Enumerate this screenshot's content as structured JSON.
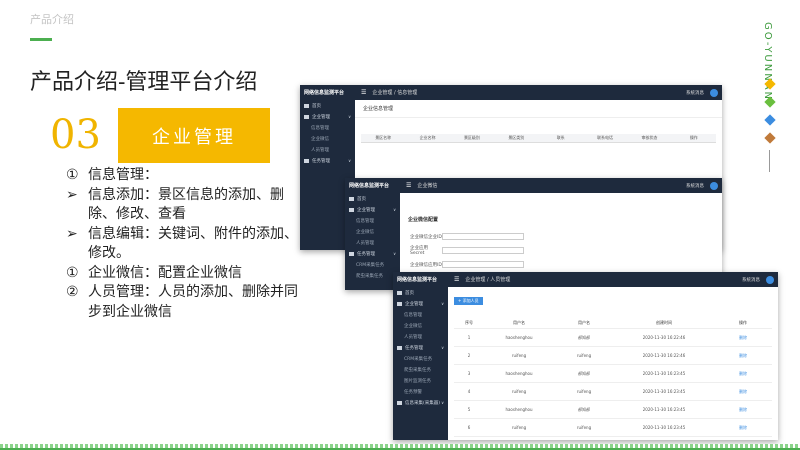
{
  "page": {
    "top_label": "产品介绍",
    "brand": "GO-YUNNAN",
    "title": "产品介绍-管理平台介绍",
    "section_number": "03",
    "section_title": "企业管理",
    "colors": {
      "accent_yellow": "#f5b800",
      "accent_green": "#4caf50",
      "diamond_1": "#f5b800",
      "diamond_2": "#6abf3e",
      "diamond_3": "#3c8de0",
      "diamond_4": "#c07a3a"
    }
  },
  "points": [
    {
      "marker": "①",
      "text": "信息管理："
    },
    {
      "marker": "➢",
      "text": "信息添加：景区信息的添加、删除、修改、查看"
    },
    {
      "marker": "➢",
      "text": "信息编辑：关键词、附件的添加、修改。"
    },
    {
      "marker": "①",
      "text": "企业微信：配置企业微信"
    },
    {
      "marker": "②",
      "text": "人员管理：人员的添加、删除并同步到企业微信"
    }
  ],
  "app": {
    "name": "网络信息监测平台",
    "sys_label": "系统消息",
    "sidebar": {
      "home": "首页",
      "enterprise": "企业管理",
      "info_manage": "信息管理",
      "enterprise_wechat": "企业微信",
      "staff": "人员管理",
      "tasks": "任务管理",
      "task_1": "CRM采集任务",
      "task_2": "爬虫采集任务",
      "task_3": "图片监测任务",
      "task_4": "任务预警",
      "info_collect": "信息采集(采集器)"
    },
    "win1": {
      "crumb": "企业管理 / 信息管理",
      "page_title": "企业信息管理",
      "columns": [
        "景区名称",
        "企业名称",
        "景区级别",
        "景区类别",
        "联系",
        "联系电话",
        "审核状态",
        "操作"
      ]
    },
    "win2": {
      "crumb": "企业微信",
      "page_title": "企业微信配置",
      "fields": [
        "企业微信企业ID",
        "企业应用Secret",
        "企业微信应用ID",
        "企业微信通讯录Secret"
      ],
      "save": "保存"
    },
    "win3": {
      "crumb": "企业管理 / 人员管理",
      "add_button": "+ 添加人员",
      "columns": [
        "序号",
        "用户名",
        "用户名",
        "创建时间",
        "操作"
      ],
      "rows": [
        {
          "no": "1",
          "user": "haoshenghou",
          "name": "郝知郝",
          "time": "2020-11-30 16:22:46",
          "op": "删除"
        },
        {
          "no": "2",
          "user": "ruifeng",
          "name": "ruifeng",
          "time": "2020-11-30 16:22:46",
          "op": "删除"
        },
        {
          "no": "3",
          "user": "haoshenghou",
          "name": "郝知郝",
          "time": "2020-11-30 16:23:45",
          "op": "删除"
        },
        {
          "no": "4",
          "user": "ruifeng",
          "name": "ruifeng",
          "time": "2020-11-30 16:23:45",
          "op": "删除"
        },
        {
          "no": "5",
          "user": "haoshenghou",
          "name": "郝知郝",
          "time": "2020-11-30 16:23:45",
          "op": "删除"
        },
        {
          "no": "6",
          "user": "ruifeng",
          "name": "ruifeng",
          "time": "2020-11-30 16:23:45",
          "op": "删除"
        }
      ]
    }
  }
}
